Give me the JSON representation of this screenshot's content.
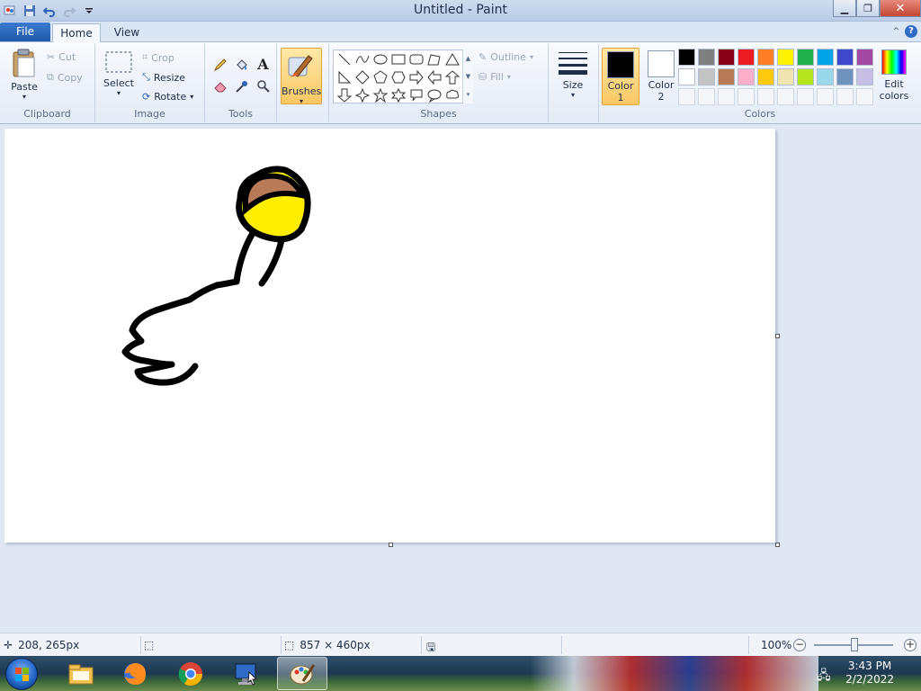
{
  "window": {
    "title": "Untitled - Paint",
    "quick_access": [
      "paint-menu-icon",
      "save-icon",
      "undo-icon",
      "redo-icon",
      "customize-qat-icon"
    ],
    "controls": {
      "minimize": "minimize-icon",
      "restore": "restore-icon",
      "close": "close-icon"
    }
  },
  "tabs": {
    "file": "File",
    "home": "Home",
    "view": "View",
    "active": "Home"
  },
  "ribbon": {
    "clipboard": {
      "label": "Clipboard",
      "paste": "Paste",
      "cut": "Cut",
      "copy": "Copy"
    },
    "image": {
      "label": "Image",
      "select": "Select",
      "crop": "Crop",
      "resize": "Resize",
      "rotate": "Rotate"
    },
    "tools": {
      "label": "Tools",
      "items": [
        "pencil-icon",
        "fill-icon",
        "text-icon",
        "eraser-icon",
        "color-picker-icon",
        "magnifier-icon"
      ]
    },
    "brushes": {
      "label": "Brushes"
    },
    "shapes": {
      "label": "Shapes",
      "outline": "Outline",
      "fill": "Fill"
    },
    "size": {
      "label": "Size"
    },
    "colors": {
      "label": "Colors",
      "color1_label": "Color",
      "color1_num": "1",
      "color1_value": "#000000",
      "color2_label": "Color",
      "color2_num": "2",
      "color2_value": "#ffffff",
      "edit_label_1": "Edit",
      "edit_label_2": "colors",
      "palette": [
        "#000000",
        "#7f7f7f",
        "#880015",
        "#ed1c24",
        "#ff7f27",
        "#fff200",
        "#22b14c",
        "#00a2e8",
        "#3f48cc",
        "#a349a4",
        "#ffffff",
        "#c3c3c3",
        "#b97a57",
        "#ffaec9",
        "#ffc90e",
        "#efe4b0",
        "#b5e61d",
        "#99d9ea",
        "#7092be",
        "#c8bfe7",
        "",
        "",
        "",
        "",
        "",
        "",
        "",
        "",
        "",
        ""
      ]
    }
  },
  "canvas": {
    "background": "#ffffff"
  },
  "statusbar": {
    "cursor_pos": "208, 265px",
    "canvas_size": "857 × 460px",
    "zoom": "100%"
  },
  "taskbar": {
    "apps": [
      "windows-explorer-icon",
      "firefox-icon",
      "chrome-icon",
      "remote-desktop-icon",
      "paint-icon"
    ],
    "time": "3:43 PM",
    "date": "2/2/2022"
  }
}
